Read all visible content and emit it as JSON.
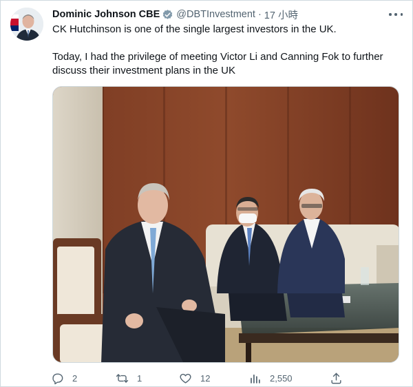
{
  "author": {
    "name": "Dominic Johnson CBE",
    "handle": "@DBTInvestment",
    "separator": "·",
    "time": "17 小時"
  },
  "tweet": {
    "line1": "CK Hutchinson is one of the single largest investors in the UK.",
    "line2": "Today, I had the privilege of meeting Victor Li and Canning Fok to further discuss their investment plans in the UK"
  },
  "actions": {
    "replies": "2",
    "retweets": "1",
    "likes": "12",
    "views": "2,550"
  },
  "colors": {
    "text": "#0f1419",
    "secondary": "#536471",
    "verified": "#829aab",
    "border": "#cfd9de"
  },
  "icons": [
    "verified-badge-icon",
    "more-icon",
    "reply-icon",
    "retweet-icon",
    "like-icon",
    "views-icon",
    "share-icon"
  ]
}
